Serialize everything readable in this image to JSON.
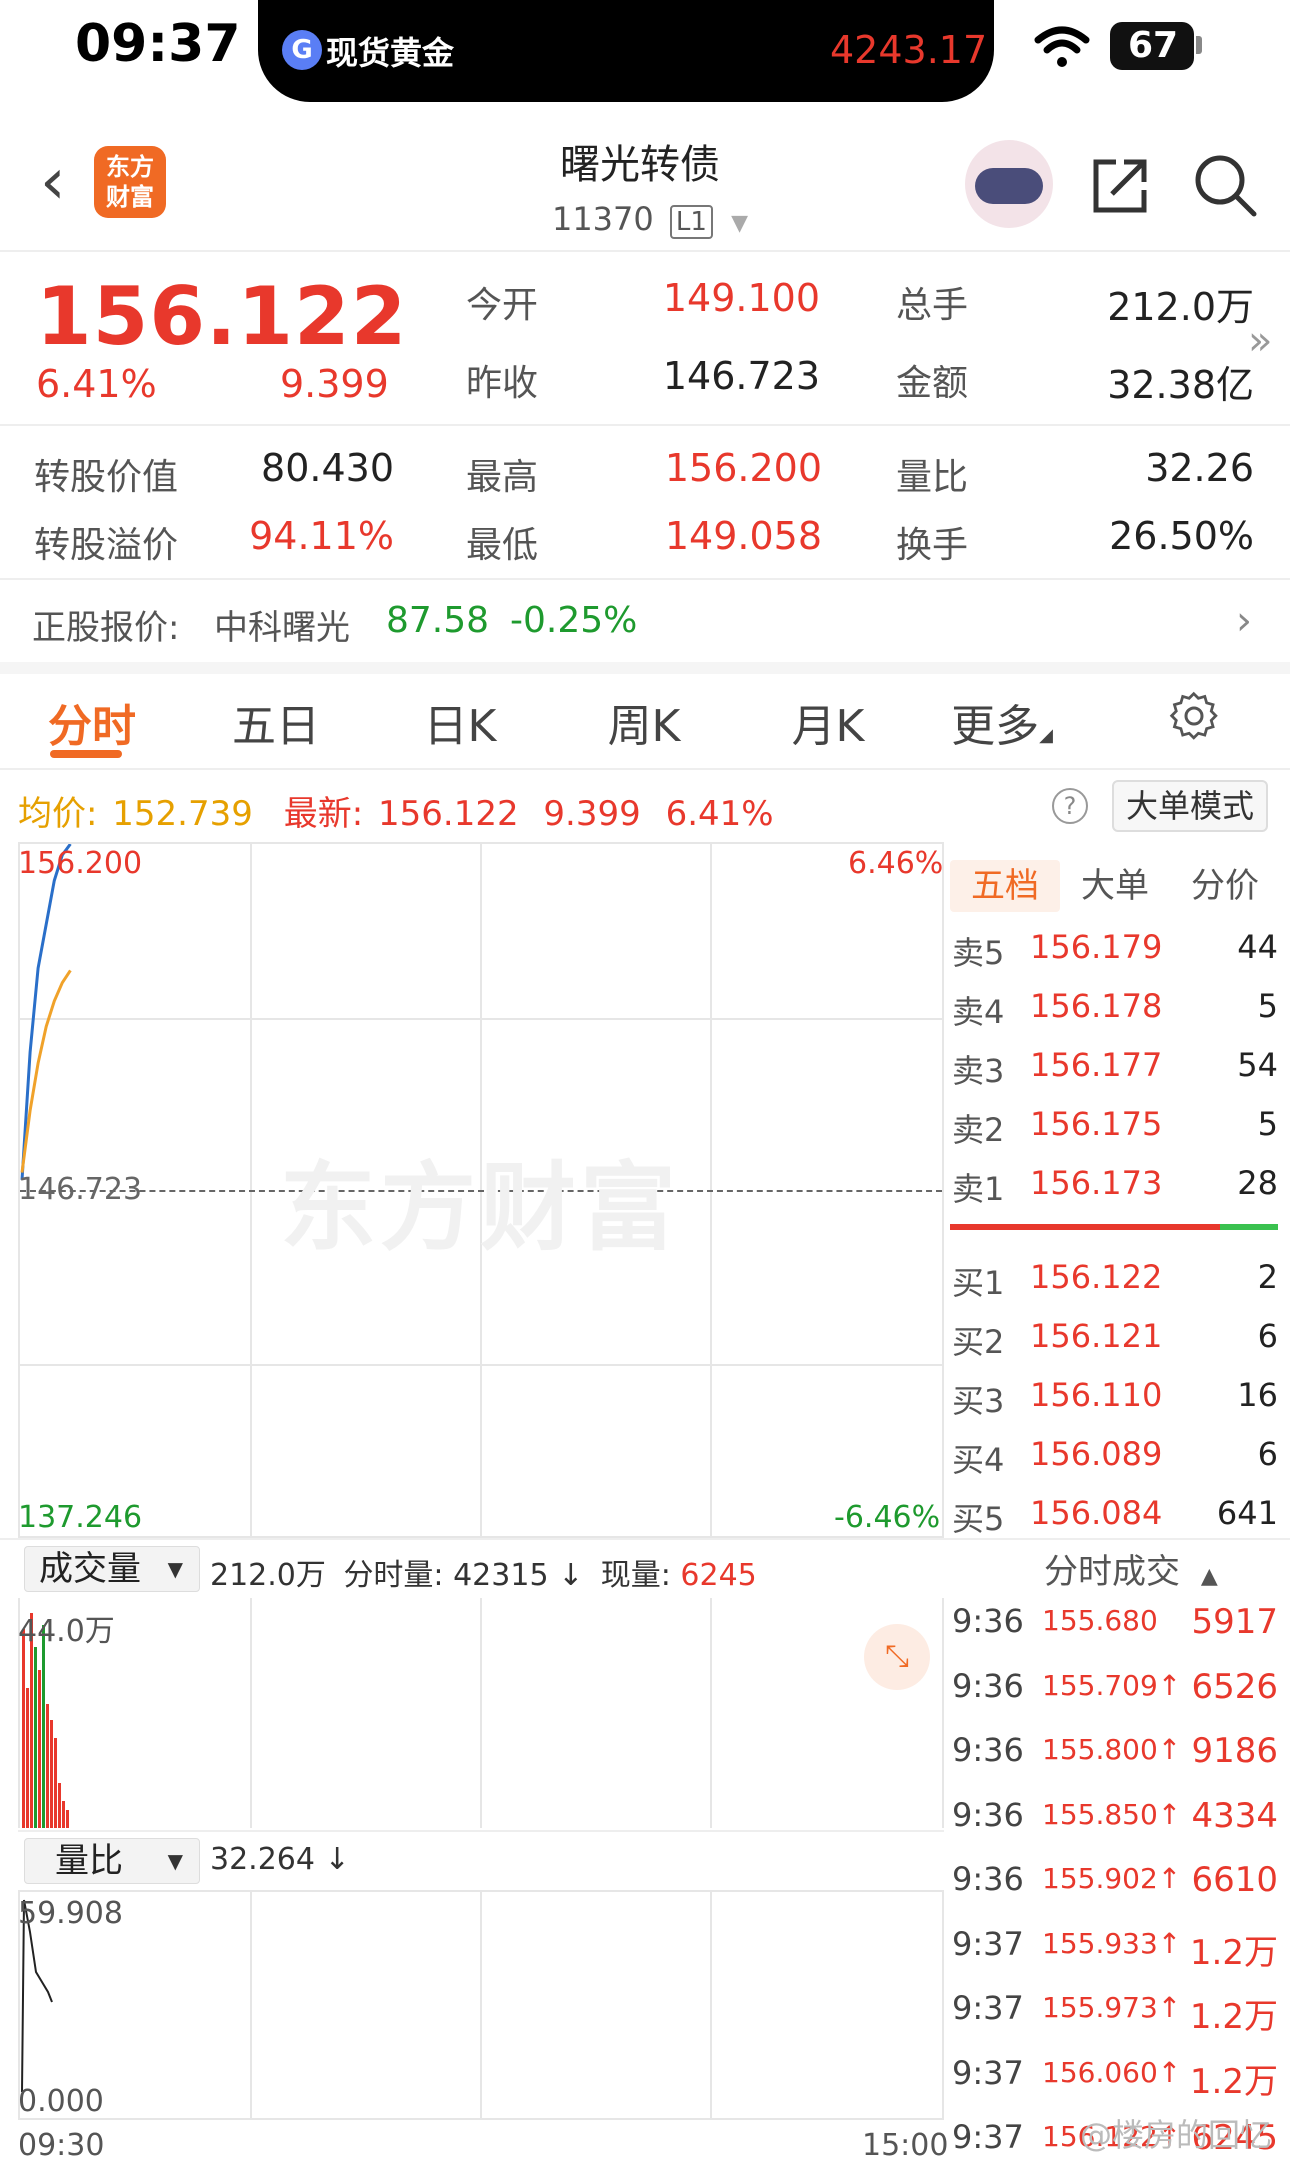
{
  "status_bar": {
    "time": "09:37",
    "island_label": "现货黄金",
    "island_icon": "G",
    "island_value": "4243.17",
    "battery": "67"
  },
  "nav": {
    "back_icon": "‹",
    "logo_line1": "东方",
    "logo_line2": "财富",
    "title": "曙光转债",
    "code": "11370",
    "level": "L1"
  },
  "quote": {
    "price": "156.122",
    "change_pct": "6.41%",
    "change": "9.399",
    "open_label": "今开",
    "open": "149.100",
    "prev_close_label": "昨收",
    "prev_close": "146.723",
    "volume_label": "总手",
    "volume": "212.0万",
    "amount_label": "金额",
    "amount": "32.38亿",
    "conv_value_label": "转股价值",
    "conv_value": "80.430",
    "high_label": "最高",
    "high": "156.200",
    "vol_ratio_label": "量比",
    "vol_ratio": "32.26",
    "conv_premium_label": "转股溢价",
    "conv_premium": "94.11%",
    "low_label": "最低",
    "low": "149.058",
    "turnover_label": "换手",
    "turnover": "26.50%"
  },
  "underlying": {
    "label": "正股报价:",
    "name": "中科曙光",
    "price": "87.58",
    "pct": "-0.25%"
  },
  "tabs": [
    "分时",
    "五日",
    "日K",
    "周K",
    "月K",
    "更多"
  ],
  "info_line": {
    "avg_label": "均价:",
    "avg": "152.739",
    "latest_label": "最新:",
    "latest": "156.122",
    "change": "9.399",
    "pct": "6.41%",
    "help": "?",
    "big_order_mode": "大单模式"
  },
  "chart": {
    "top_price": "156.200",
    "top_pct": "6.46%",
    "mid_price": "146.723",
    "bottom_price": "137.246",
    "bottom_pct": "-6.46%",
    "watermark": "东方财富",
    "colors": {
      "price_line": "#2a6fc9",
      "avg_line": "#f0a22a",
      "up": "#e8382c",
      "down": "#1e9a2e"
    }
  },
  "chart_data": {
    "type": "line",
    "title": "",
    "xlabel": "",
    "ylabel": "",
    "x_range": [
      "09:30",
      "15:00"
    ],
    "ylim": [
      137.246,
      156.2
    ],
    "x": [
      "09:30",
      "09:31",
      "09:32",
      "09:33",
      "09:34",
      "09:35",
      "09:36"
    ],
    "series": [
      {
        "values": [
          147.0,
          150.5,
          152.8,
          154.0,
          155.2,
          155.9,
          156.2
        ]
      },
      {
        "values": [
          147.2,
          148.9,
          150.2,
          151.2,
          151.9,
          152.4,
          152.739
        ]
      }
    ]
  },
  "order_book": {
    "tabs": [
      "五档",
      "大单",
      "分价"
    ],
    "asks": [
      {
        "label": "卖5",
        "price": "156.179",
        "qty": "44"
      },
      {
        "label": "卖4",
        "price": "156.178",
        "qty": "5"
      },
      {
        "label": "卖3",
        "price": "156.177",
        "qty": "54"
      },
      {
        "label": "卖2",
        "price": "156.175",
        "qty": "5"
      },
      {
        "label": "卖1",
        "price": "156.173",
        "qty": "28"
      }
    ],
    "bids": [
      {
        "label": "买1",
        "price": "156.122",
        "qty": "2"
      },
      {
        "label": "买2",
        "price": "156.121",
        "qty": "6"
      },
      {
        "label": "买3",
        "price": "156.110",
        "qty": "16"
      },
      {
        "label": "买4",
        "price": "156.089",
        "qty": "6"
      },
      {
        "label": "买5",
        "price": "156.084",
        "qty": "641"
      }
    ]
  },
  "volume_panel": {
    "selector": "成交量",
    "total": "212.0万",
    "minute_label": "分时量:",
    "minute_value": "42315 ↓",
    "current_label": "现量:",
    "current_value": "6245",
    "max_label": "44.0万",
    "expand_icon": "⤡",
    "bar_values": [
      0.88,
      0.62,
      0.95,
      0.8,
      0.7,
      0.9,
      0.55,
      0.48,
      0.4,
      0.2,
      0.12,
      0.08
    ],
    "bar_up": [
      true,
      true,
      true,
      false,
      true,
      false,
      true,
      true,
      true,
      true,
      true,
      true
    ]
  },
  "trades": {
    "header": "分时成交",
    "rows": [
      {
        "time": "9:36",
        "price": "155.680",
        "vol": "5917"
      },
      {
        "time": "9:36",
        "price": "155.709↑",
        "vol": "6526"
      },
      {
        "time": "9:36",
        "price": "155.800↑",
        "vol": "9186"
      },
      {
        "time": "9:36",
        "price": "155.850↑",
        "vol": "4334"
      },
      {
        "time": "9:36",
        "price": "155.902↑",
        "vol": "6610"
      },
      {
        "time": "9:37",
        "price": "155.933↑",
        "vol": "1.2万"
      },
      {
        "time": "9:37",
        "price": "155.973↑",
        "vol": "1.2万"
      },
      {
        "time": "9:37",
        "price": "156.060↑",
        "vol": "1.2万"
      },
      {
        "time": "9:37",
        "price": "156.122↑",
        "vol": "6245"
      }
    ]
  },
  "vol_ratio_panel": {
    "selector": "量比",
    "value": "32.264 ↓",
    "max_label": "59.908",
    "min_label": "0.000",
    "start_time": "09:30",
    "end_time": "15:00"
  },
  "watermark_footer": "@楼房的回忆"
}
